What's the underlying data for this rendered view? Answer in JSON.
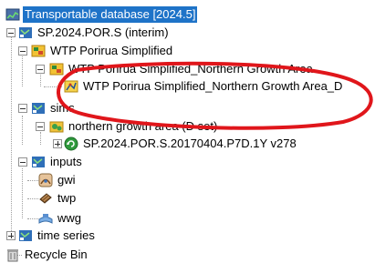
{
  "tree": {
    "root_label": "Transportable database [2024.5]",
    "sp_label": "SP.2024.POR.S (interim)",
    "wtp_label": "WTP Porirua Simplified",
    "northern_label": "WTP Porirua Simplified_Northern Growth Area",
    "northern_d_label": "WTP Porirua Simplified_Northern Growth Area_D",
    "sims_label": "sims",
    "ngaset_label": "northern growth area (D set)",
    "sim_run_label": "SP.2024.POR.S.20170404.P7D.1Y v278",
    "inputs_label": "inputs",
    "gwi_label": "gwi",
    "twp_label": "twp",
    "wwg_label": "wwg",
    "timeseries_label": "time series",
    "recycle_label": "Recycle Bin"
  },
  "colors": {
    "selection": "#1e73c8",
    "annotation": "#e0161b"
  }
}
